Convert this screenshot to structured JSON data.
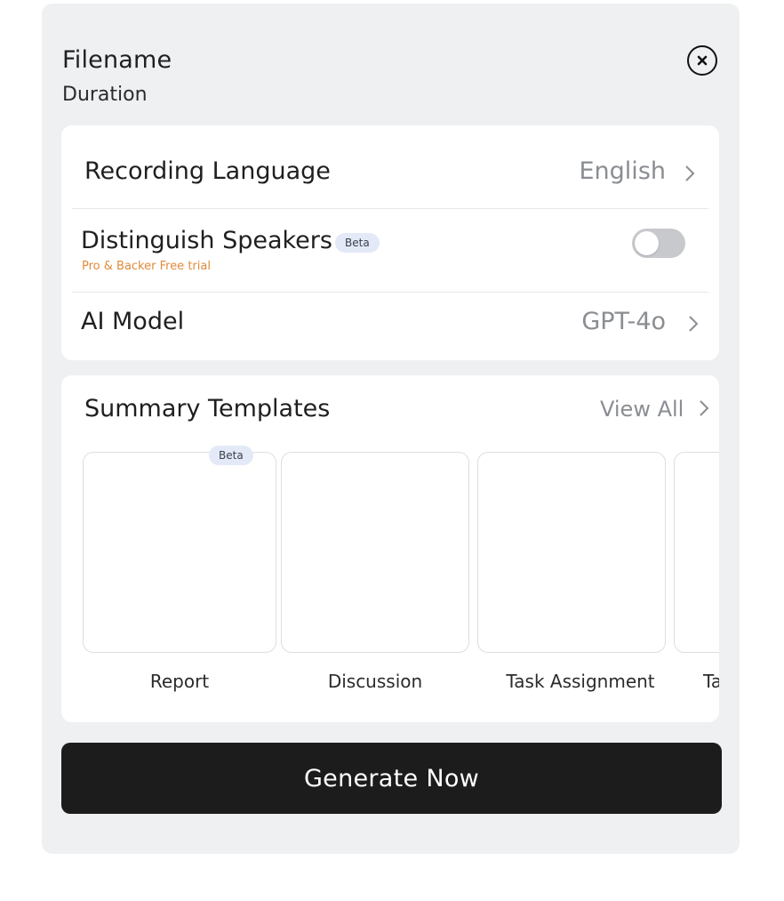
{
  "header": {
    "filename": "Filename",
    "duration": "Duration"
  },
  "settings": {
    "recording_language": {
      "label": "Recording Language",
      "value": "English"
    },
    "distinguish_speakers": {
      "label": "Distinguish Speakers",
      "badge": "Beta",
      "note": "Pro & Backer Free trial",
      "enabled": false
    },
    "ai_model": {
      "label": "AI Model",
      "value": "GPT-4o"
    }
  },
  "templates": {
    "title": "Summary Templates",
    "view_all": "View All",
    "items": [
      {
        "label": "Report",
        "badge": "Beta"
      },
      {
        "label": "Discussion"
      },
      {
        "label": "Task Assignment"
      },
      {
        "label": "Ta"
      }
    ]
  },
  "actions": {
    "generate": "Generate Now"
  },
  "colors": {
    "panel_bg": "#eef0f2",
    "card_bg": "#ffffff",
    "primary_button": "#1c1c1c",
    "promo_text": "#e08a3a",
    "badge_bg": "#e3e9f7",
    "muted_text": "#8a8d92"
  }
}
